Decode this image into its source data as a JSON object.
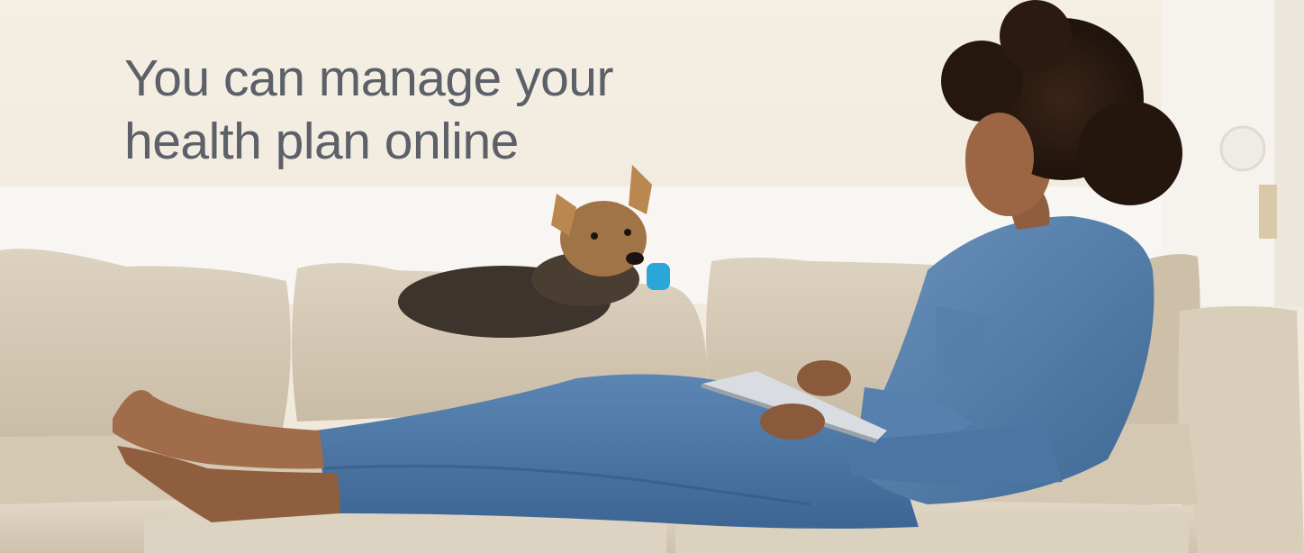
{
  "hero": {
    "headline_line1": "You can manage your",
    "headline_line2": "health plan online"
  },
  "colors": {
    "headline": "#5c6068",
    "wall": "#f3ede2",
    "sofa": "#d8cbb6",
    "denim": "#4f79a8"
  }
}
